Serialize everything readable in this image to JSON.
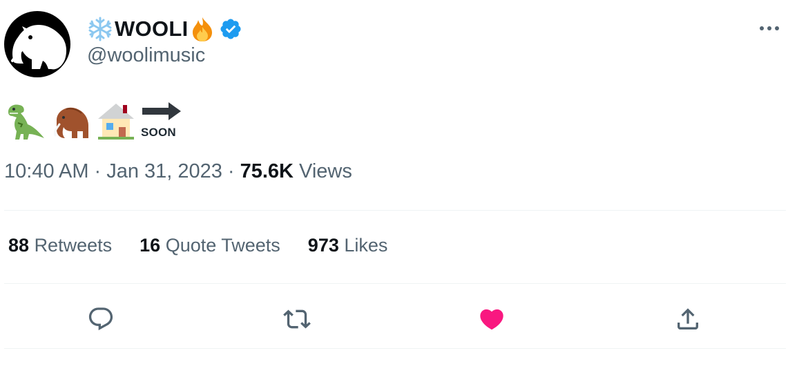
{
  "author": {
    "display_name": "WOOLI",
    "name_prefix_emoji": "snowflake-emoji",
    "name_suffix_emoji": "fire-emoji",
    "verified": true,
    "handle": "@woolimusic",
    "avatar": "mammoth-logo"
  },
  "tweet": {
    "emojis": [
      "t-rex-emoji",
      "mammoth-emoji",
      "house-emoji",
      "soon-arrow-emoji"
    ],
    "soon_label": "SOON",
    "time": "10:40 AM",
    "separator": "·",
    "date": "Jan 31, 2023",
    "views_count": "75.6K",
    "views_label": "Views"
  },
  "stats": {
    "retweets_count": "88",
    "retweets_label": "Retweets",
    "quotes_count": "16",
    "quotes_label": "Quote Tweets",
    "likes_count": "973",
    "likes_label": "Likes"
  },
  "actions": {
    "reply_icon": "reply-icon",
    "retweet_icon": "retweet-icon",
    "like_icon": "heart-icon",
    "share_icon": "share-icon",
    "liked": true
  },
  "colors": {
    "verified_blue": "#1d9bf0",
    "like_pink": "#f91880",
    "secondary_text": "#536471",
    "divider": "#eff3f4"
  }
}
